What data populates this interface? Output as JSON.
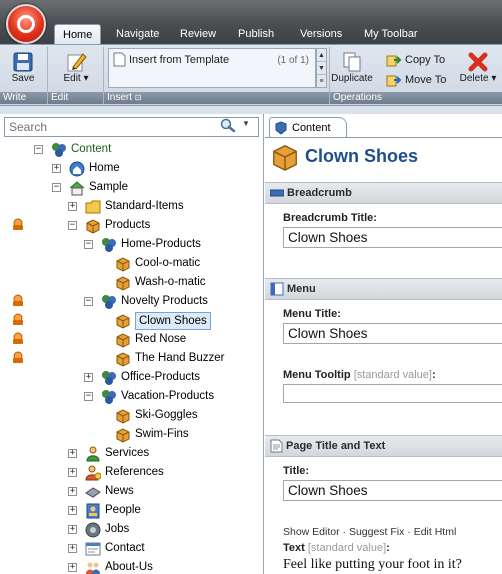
{
  "ribbon": {
    "tabs": [
      "Home",
      "Navigate",
      "Review",
      "Publish",
      "Versions",
      "My Toolbar"
    ],
    "write": {
      "save_label": "Save",
      "group_label": "Write"
    },
    "edit": {
      "edit_label": "Edit",
      "group_label": "Edit"
    },
    "insert": {
      "item_label": "Insert from Template",
      "count": "(1 of 1)",
      "group_label": "Insert"
    },
    "operations": {
      "duplicate_label": "Duplicate",
      "copy_to_label": "Copy To",
      "move_to_label": "Move To",
      "delete_label": "Delete",
      "group_label": "Operations"
    }
  },
  "search": {
    "placeholder": "Search"
  },
  "tree": {
    "content": "Content",
    "home": "Home",
    "sample": "Sample",
    "standard_items": "Standard-Items",
    "products": "Products",
    "home_products": "Home-Products",
    "cool_o_matic": "Cool-o-matic",
    "wash_o_matic": "Wash-o-matic",
    "novelty_products": "Novelty Products",
    "clown_shoes": "Clown Shoes",
    "red_nose": "Red Nose",
    "hand_buzzer": "The Hand Buzzer",
    "office_products": "Office-Products",
    "vacation_products": "Vacation-Products",
    "ski_goggles": "Ski-Goggles",
    "swim_fins": "Swim-Fins",
    "services": "Services",
    "references": "References",
    "news": "News",
    "people": "People",
    "jobs": "Jobs",
    "contact": "Contact",
    "about_us": "About-Us"
  },
  "editor": {
    "tab_label": "Content",
    "item_title": "Clown Shoes",
    "breadcrumb": {
      "section": "Breadcrumb",
      "field_label": "Breadcrumb Title:",
      "value": "Clown Shoes"
    },
    "menu": {
      "section": "Menu",
      "title_label": "Menu Title:",
      "title_value": "Clown Shoes",
      "tooltip_label": "Menu Tooltip",
      "tooltip_std": "[standard value]",
      "tooltip_colon": ":",
      "tooltip_value": ""
    },
    "page": {
      "section": "Page Title and Text",
      "title_label": "Title:",
      "title_value": "Clown Shoes",
      "links": "Show Editor · Suggest Fix · Edit Html",
      "text_label": "Text",
      "text_std": "[standard value]",
      "text_colon": ":",
      "text_value": "Feel like putting your foot in it?"
    }
  }
}
